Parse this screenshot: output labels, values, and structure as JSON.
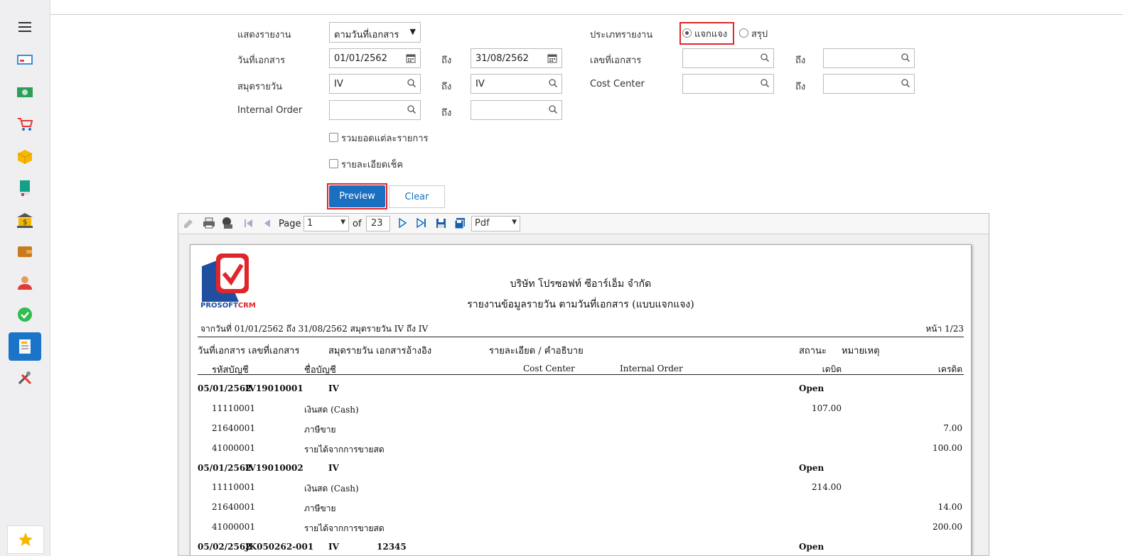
{
  "form": {
    "show_report_label": "แสดงรายงาน",
    "show_report_value": "ตามวันที่เอกสาร",
    "report_type_label": "ประเภทรายงาน",
    "report_type_option_detail": "แจกแจง",
    "report_type_option_summary": "สรุป",
    "doc_date_label": "วันที่เอกสาร",
    "doc_date_from": "01/01/2562",
    "to_label": "ถึง",
    "doc_date_to": "31/08/2562",
    "doc_no_label": "เลขที่เอกสาร",
    "journal_label": "สมุดรายวัน",
    "journal_from": "IV",
    "journal_to": "IV",
    "cost_center_label": "Cost Center",
    "internal_order_label": "Internal Order",
    "sum_each_label": "รวมยอดแต่ละรายการ",
    "cheque_detail_label": "รายละเอียดเช็ค",
    "preview_label": "Preview",
    "clear_label": "Clear"
  },
  "viewer": {
    "page_label": "Page",
    "page_value": "1",
    "of_label": "of",
    "total_pages": "23",
    "format_value": "Pdf"
  },
  "report": {
    "logo_text_a": "PROSOFT",
    "logo_text_b": "CRM",
    "company": "บริษัท โปรซอฟท์ ซีอาร์เอ็ม จำกัด",
    "title": "รายงานข้อมูลรายวัน ตามวันที่เอกสาร (แบบแจกแจง)",
    "criteria": "จากวันที่ 01/01/2562 ถึง 31/08/2562 สมุดรายวัน IV ถึง IV",
    "page_info": "หน้า 1/23",
    "headers": {
      "doc_date_no": "วันที่เอกสาร  เลขที่เอกสาร",
      "journal_ref": "สมุดรายวัน  เอกสารอ้างอิง",
      "description": "รายละเอียด / คำอธิบาย",
      "status": "สถานะ",
      "remark": "หมายเหตุ",
      "account_code": "รหัสบัญชี",
      "account_name": "ชื่อบัญชี",
      "cost_center": "Cost Center",
      "internal_order": "Internal Order",
      "debit": "เดบิต",
      "credit": "เครดิต"
    },
    "docs": [
      {
        "date": "05/01/2562",
        "no": "IV19010001",
        "journal": "IV",
        "ref": "",
        "status": "Open",
        "lines": [
          {
            "code": "11110001",
            "name": "เงินสด (Cash)",
            "debit": "107.00",
            "credit": ""
          },
          {
            "code": "21640001",
            "name": "ภาษีขาย",
            "debit": "",
            "credit": "7.00"
          },
          {
            "code": "41000001",
            "name": "รายได้จากการขายสด",
            "debit": "",
            "credit": "100.00"
          }
        ]
      },
      {
        "date": "05/01/2562",
        "no": "IV19010002",
        "journal": "IV",
        "ref": "",
        "status": "Open",
        "lines": [
          {
            "code": "11110001",
            "name": "เงินสด (Cash)",
            "debit": "214.00",
            "credit": ""
          },
          {
            "code": "21640001",
            "name": "ภาษีขาย",
            "debit": "",
            "credit": "14.00"
          },
          {
            "code": "41000001",
            "name": "รายได้จากการขายสด",
            "debit": "",
            "credit": "200.00"
          }
        ]
      },
      {
        "date": "05/02/2562",
        "no": "JK050262-001",
        "journal": "IV",
        "ref": "12345",
        "status": "Open",
        "lines": []
      }
    ]
  },
  "colors": {
    "primary": "#1b74c8",
    "highlight": "#e0262b"
  }
}
